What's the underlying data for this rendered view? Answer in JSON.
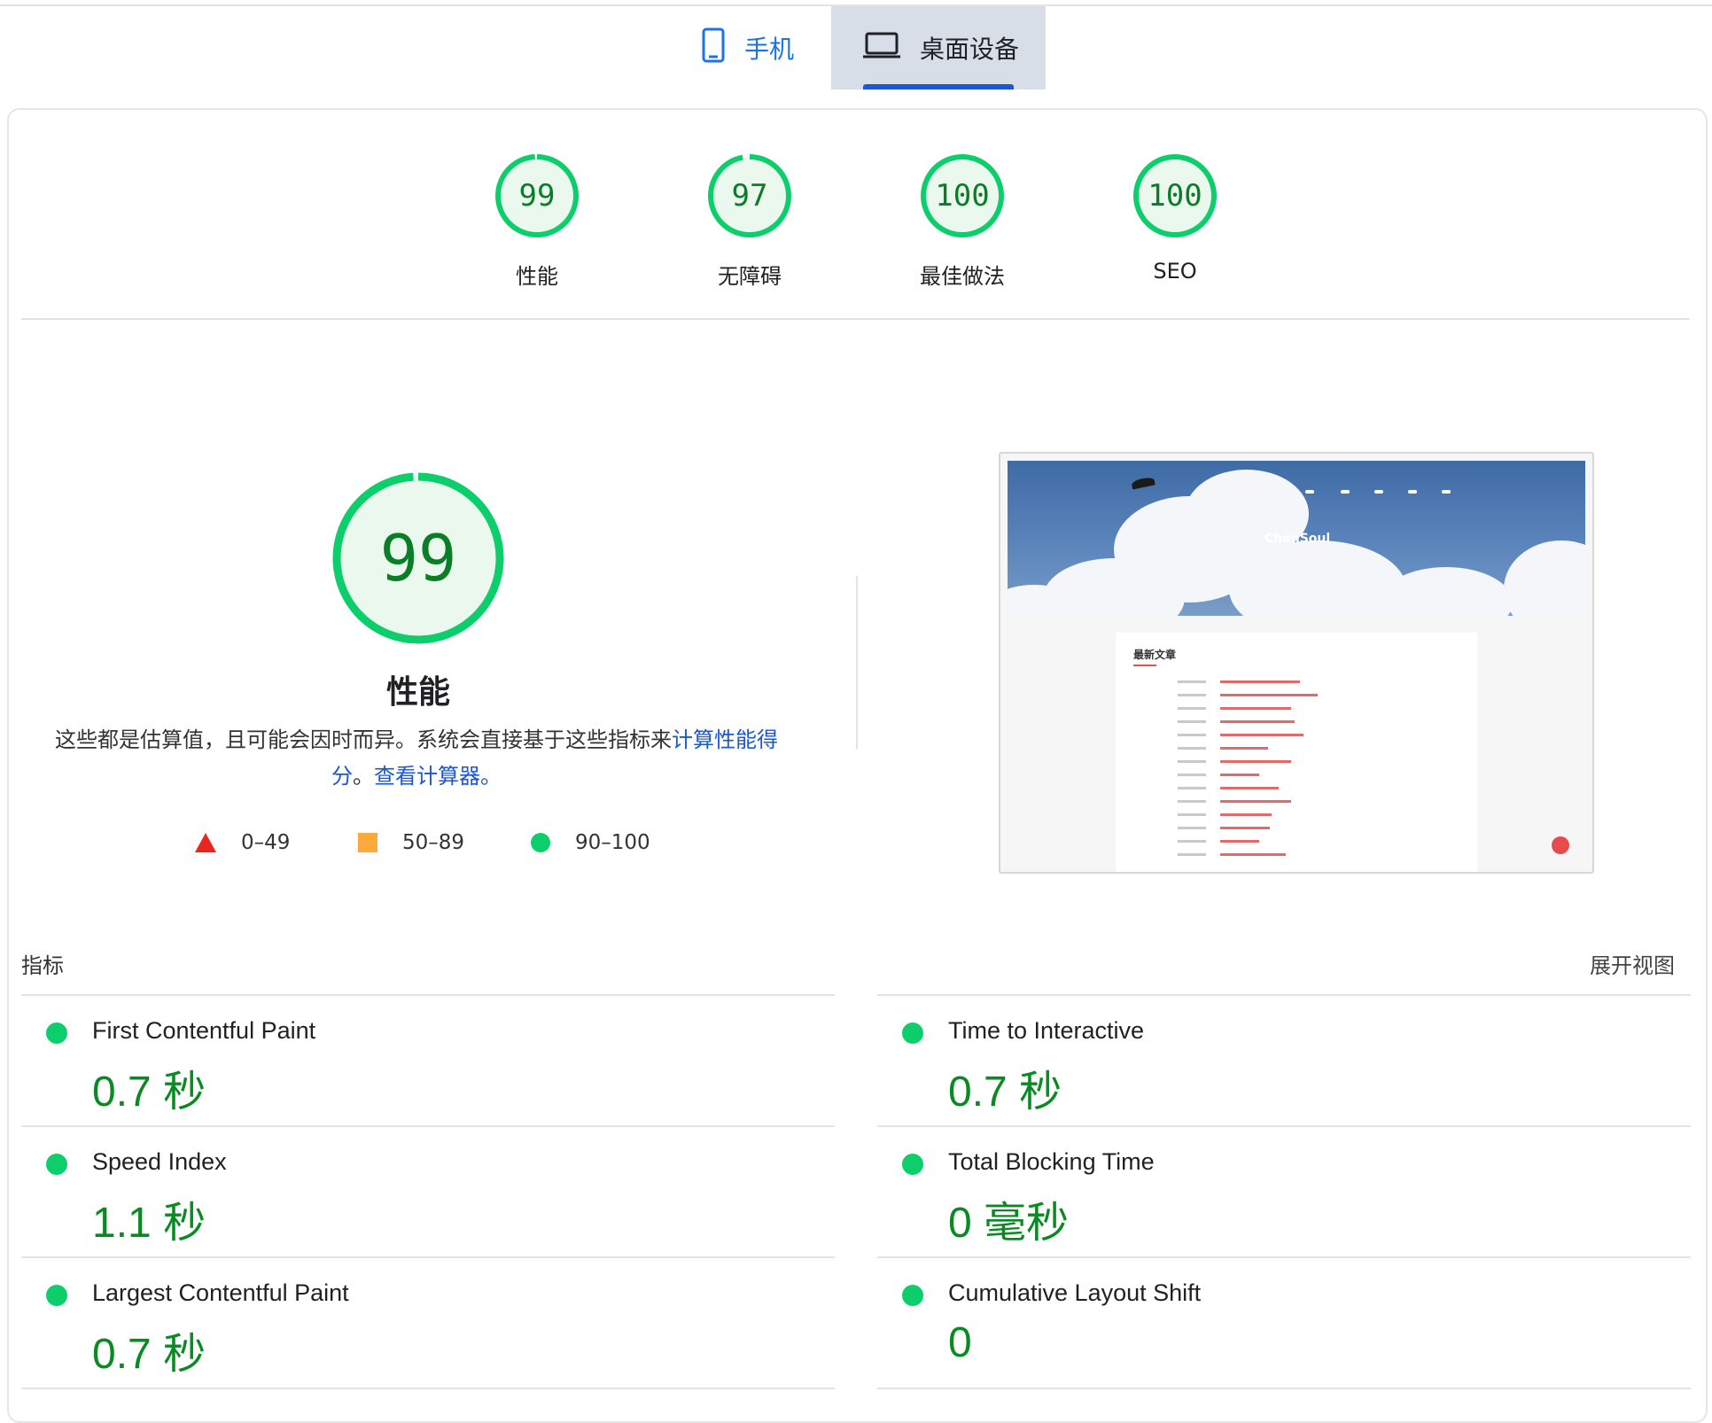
{
  "tabs": {
    "mobile": "手机",
    "desktop": "桌面设备"
  },
  "scores": [
    {
      "score": "99",
      "label": "性能"
    },
    {
      "score": "97",
      "label": "无障碍"
    },
    {
      "score": "100",
      "label": "最佳做法"
    },
    {
      "score": "100",
      "label": "SEO"
    }
  ],
  "performance": {
    "score": "99",
    "title": "性能",
    "description_prefix": "这些都是估算值，且可能会因时而异。系统会直接基于这些指标来",
    "calc_link": "计算性能得分",
    "sep": "。",
    "calculator_link": "查看计算器",
    "end": "。"
  },
  "legend": {
    "fail": "0–49",
    "average": "50–89",
    "pass": "90–100"
  },
  "preview": {
    "site_title": "ChenSoul",
    "latest_heading": "最新文章"
  },
  "metrics": {
    "title": "指标",
    "expand_view": "展开视图",
    "items": [
      {
        "name": "First Contentful Paint",
        "value": "0.7 秒"
      },
      {
        "name": "Time to Interactive",
        "value": "0.7 秒"
      },
      {
        "name": "Speed Index",
        "value": "1.1 秒"
      },
      {
        "name": "Total Blocking Time",
        "value": "0 毫秒"
      },
      {
        "name": "Largest Contentful Paint",
        "value": "0.7 秒"
      },
      {
        "name": "Cumulative Layout Shift",
        "value": "0"
      }
    ]
  },
  "colors": {
    "pass": "#0cce6b",
    "pass_text": "#0a8a23",
    "average": "#fba93a",
    "fail": "#e8261c",
    "link": "#1a56d6"
  }
}
